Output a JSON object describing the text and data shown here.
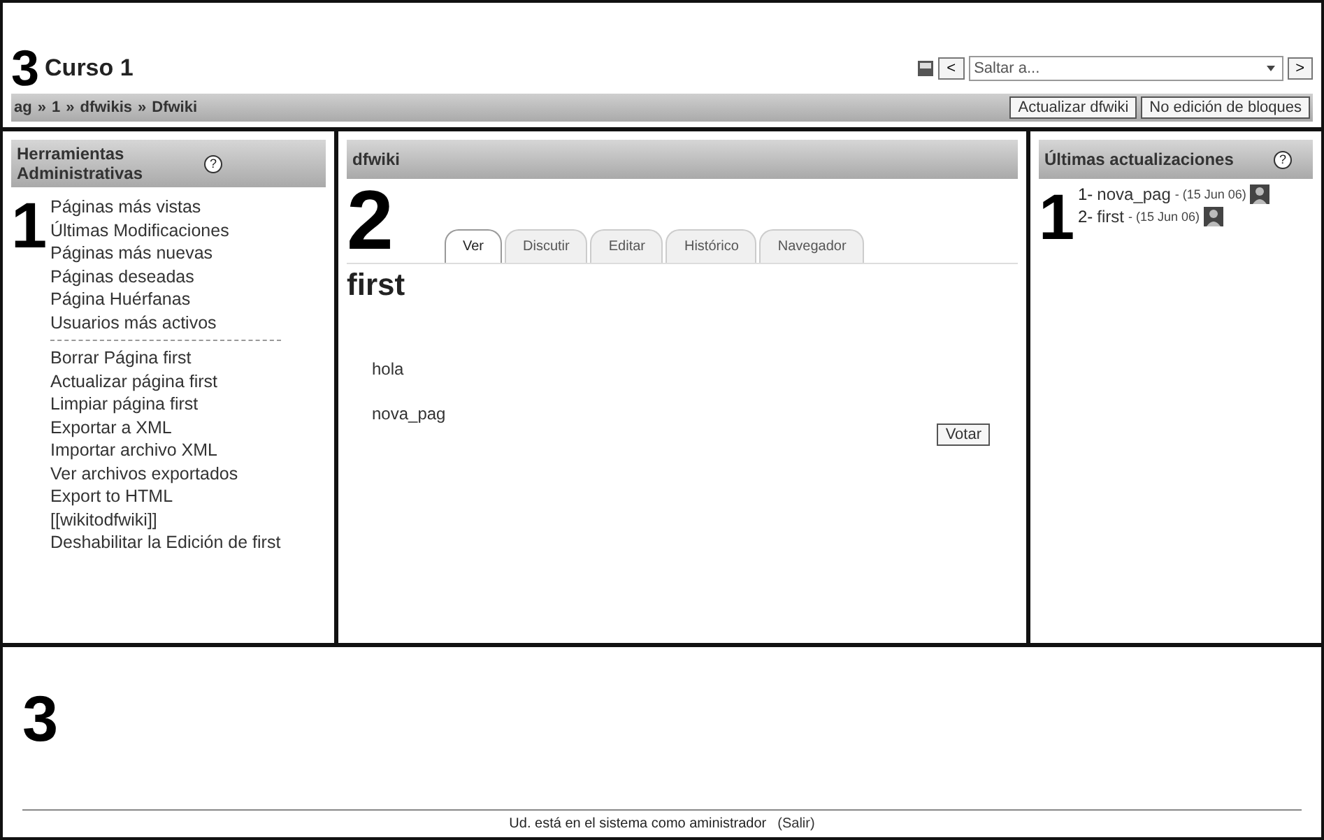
{
  "header": {
    "marker": "3",
    "title": "Curso 1",
    "jump": {
      "prev": "<",
      "select": "Saltar a...",
      "next": ">"
    },
    "breadcrumb": [
      "ag",
      "1",
      "dfwikis",
      "Dfwiki"
    ],
    "separator": "»",
    "buttons": [
      "Actualizar dfwiki",
      "No edición de bloques"
    ]
  },
  "admin_block": {
    "marker": "1",
    "title": "Herramientas Administrativas",
    "help": "?",
    "groups": [
      [
        "Páginas más vistas",
        "Últimas Modificaciones",
        "Páginas más nuevas",
        "Páginas deseadas",
        "Página Huérfanas",
        "Usuarios más activos"
      ],
      [
        "Borrar Página first",
        "Actualizar página first",
        "Limpiar página first",
        "Exportar a XML",
        "Importar archivo XML",
        "Ver archivos exportados",
        "Export to HTML",
        "[[wikitodfwiki]]",
        "Deshabilitar la Edición de first"
      ]
    ]
  },
  "main": {
    "marker": "2",
    "title": "dfwiki",
    "tabs": [
      {
        "label": "Ver",
        "selected": true
      },
      {
        "label": "Discutir",
        "selected": false
      },
      {
        "label": "Editar",
        "selected": false
      },
      {
        "label": "Histórico",
        "selected": false
      },
      {
        "label": "Navegador",
        "selected": false
      }
    ],
    "page_title": "first",
    "links": [
      "hola",
      "nova_pag"
    ],
    "button": "Votar"
  },
  "updates_block": {
    "marker": "1",
    "title": "Últimas actualizaciones",
    "help": "?",
    "items": [
      {
        "number": "1-",
        "page": "nova_pag",
        "date": "- (15 Jun 06)"
      },
      {
        "number": "2-",
        "page": "first",
        "date": "- (15 Jun 06)"
      }
    ]
  },
  "footer": {
    "marker": "3",
    "login_text": "Ud. está en el sistema como aministrador",
    "logout": "(Salir)"
  }
}
